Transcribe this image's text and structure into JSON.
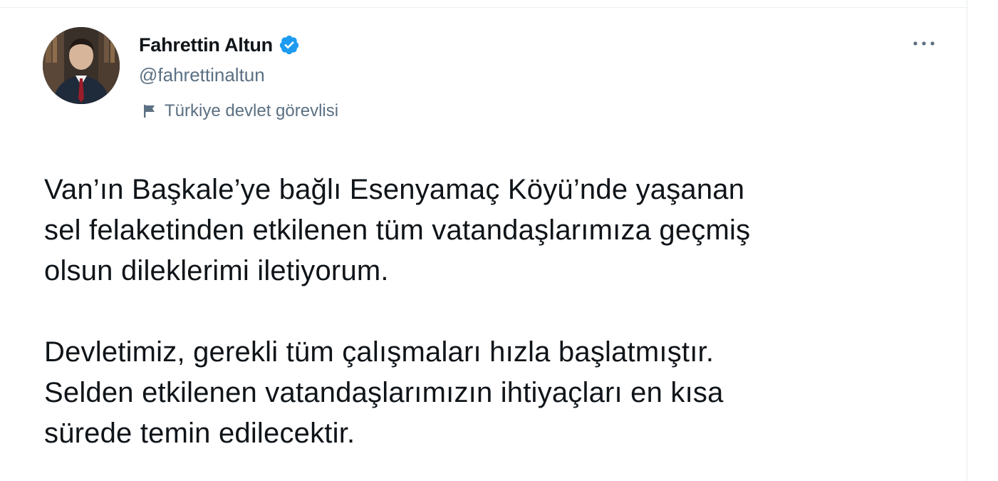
{
  "tweet": {
    "author": {
      "name": "Fahrettin Altun",
      "handle": "@fahrettinaltun",
      "verified": true,
      "affiliation": "Türkiye devlet görevlisi"
    },
    "more_label": "···",
    "paragraphs": [
      "Van’ın Başkale’ye bağlı Esenyamaç Köyü’nde yaşanan\nsel felaketinden etkilenen tüm vatandaşlarımıza geçmiş\nolsun dileklerimi iletiyorum.",
      "Devletimiz, gerekli tüm çalışmaları hızla başlatmıştır.\nSelden etkilenen vatandaşlarımızın ihtiyaçları en kısa\nsürede temin edilecektir."
    ]
  },
  "icons": {
    "verified": "verified-badge-icon",
    "affiliation": "flag-icon",
    "more": "more-options-icon"
  },
  "colors": {
    "text_primary": "#0f1419",
    "text_secondary": "#5b7083",
    "verified_blue": "#1d9bf0",
    "background": "#ffffff"
  }
}
